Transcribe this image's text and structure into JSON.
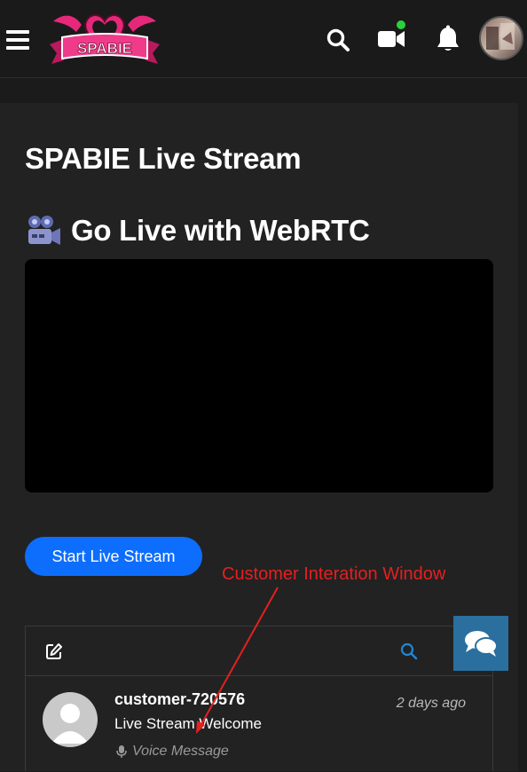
{
  "brand": {
    "logo_text": "SPABIE",
    "accent": "#e6287a"
  },
  "header": {
    "icons": [
      "menu-icon",
      "search-icon",
      "video-camera-icon",
      "bell-icon"
    ],
    "online_status_color": "#2ad13d"
  },
  "page": {
    "title": "SPABIE Live Stream",
    "section_title": "Go Live with WebRTC",
    "start_button": "Start Live Stream",
    "start_button_color": "#0d6efd"
  },
  "annotation": {
    "label": "Customer Interation Window",
    "color": "#e42020"
  },
  "chat": {
    "conversations": [
      {
        "name": "customer-720576",
        "time": "2 days ago",
        "message": "Live Stream Welcome",
        "preview": "Voice Message"
      }
    ]
  }
}
